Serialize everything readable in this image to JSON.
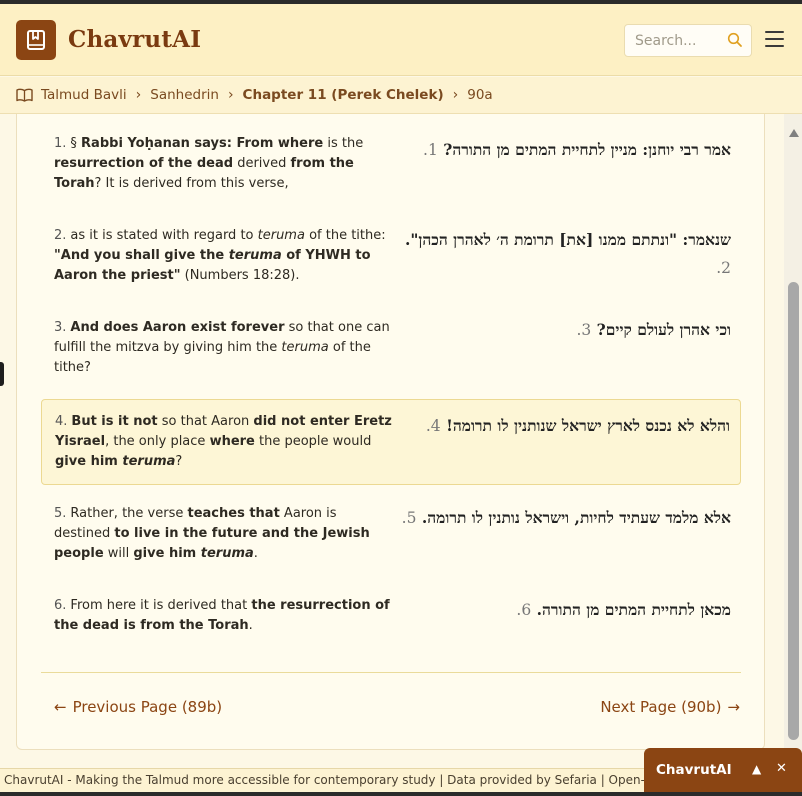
{
  "header": {
    "brand": "ChavrutAI",
    "search_placeholder": "Search...",
    "accent_color": "#8b4513",
    "icons": [
      "book-logo-icon",
      "search-icon",
      "hamburger-menu-icon"
    ]
  },
  "breadcrumb": {
    "items": [
      "Talmud Bavli",
      "Sanhedrin",
      "Chapter 11 (Perek Chelek)",
      "90a"
    ]
  },
  "passages": [
    {
      "num": "1.",
      "en": [
        [
          "",
          "§ "
        ],
        [
          "b",
          "Rabbi Yoḥanan says: From where"
        ],
        [
          "",
          " is the "
        ],
        [
          "b",
          "resurrection of the dead"
        ],
        [
          "",
          " derived "
        ],
        [
          "b",
          "from the Torah"
        ],
        [
          "",
          "? It is derived from this verse,"
        ]
      ],
      "he": "אמר רבי יוחנן: מניין לתחיית המתים מן התורה?"
    },
    {
      "num": "2.",
      "en": [
        [
          "",
          "as it is stated with regard to "
        ],
        [
          "i",
          "teruma"
        ],
        [
          "",
          " of the tithe: "
        ],
        [
          "b",
          "\"And you shall give the "
        ],
        [
          "bi",
          "teruma"
        ],
        [
          "b",
          " of YHWH to Aaron the priest\""
        ],
        [
          "",
          " (Numbers 18:28)."
        ]
      ],
      "he": "שנאמר: \"ונתתם ממנו [את] תרומת ה׳ לאהרן הכהן\"."
    },
    {
      "num": "3.",
      "en": [
        [
          "b",
          "And does Aaron exist forever"
        ],
        [
          "",
          " so that one can fulfill the mitzva by giving him the "
        ],
        [
          "i",
          "teruma"
        ],
        [
          "",
          " of the tithe?"
        ]
      ],
      "he": "וכי אהרן לעולם קיים?"
    },
    {
      "num": "4.",
      "en": [
        [
          "b",
          "But is it not"
        ],
        [
          "",
          " so that Aaron "
        ],
        [
          "b",
          "did not enter Eretz Yisrael"
        ],
        [
          "",
          ", the only place "
        ],
        [
          "b",
          "where"
        ],
        [
          "",
          " the people would "
        ],
        [
          "b",
          "give him "
        ],
        [
          "bi",
          "teruma"
        ],
        [
          "",
          "?"
        ]
      ],
      "he": "והלא לא נכנס לארץ ישראל שנותנין לו תרומה!"
    },
    {
      "num": "5.",
      "en": [
        [
          "",
          "Rather, the verse "
        ],
        [
          "b",
          "teaches that"
        ],
        [
          "",
          " Aaron is destined "
        ],
        [
          "b",
          "to live in the future and the Jewish people"
        ],
        [
          "",
          " will "
        ],
        [
          "b",
          "give him "
        ],
        [
          "bi",
          "teruma"
        ],
        [
          "",
          "."
        ]
      ],
      "he": "אלא מלמד שעתיד לחיות, וישראל נותנין לו תרומה."
    },
    {
      "num": "6.",
      "en": [
        [
          "",
          "From here it is derived that "
        ],
        [
          "b",
          "the resurrection of the dead is from the Torah"
        ],
        [
          "",
          "."
        ]
      ],
      "he": "מכאן לתחיית המתים מן התורה."
    }
  ],
  "highlighted_passage": 4,
  "pager": {
    "prev": "Previous Page (89b)",
    "next": "Next Page (90b)"
  },
  "footer": {
    "text": "ChavrutAI - Making the Talmud more accessible for contemporary study | Data provided by Sefaria | Open-source project"
  },
  "widget": {
    "title": "ChavrutAI",
    "toggle": "▲",
    "close": "✕"
  }
}
